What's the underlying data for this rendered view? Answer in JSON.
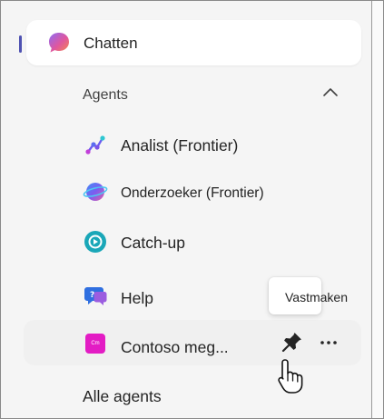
{
  "chat": {
    "label": "Chatten",
    "active": true
  },
  "agents_section": {
    "title": "Agents",
    "expanded": true,
    "items": [
      {
        "label": "Analist (Frontier)",
        "icon": "analist-icon"
      },
      {
        "label": "Onderzoeker (Frontier)",
        "icon": "onderzoeker-icon"
      },
      {
        "label": "Catch-up",
        "icon": "catch-up-icon"
      },
      {
        "label": "Help",
        "icon": "help-icon"
      },
      {
        "label": "Contoso meg...",
        "icon": "contoso-icon",
        "icon_text": "Cm",
        "hovered": true
      }
    ]
  },
  "tooltip": {
    "text": "Vastmaken"
  },
  "all_agents": {
    "label": "Alle agents"
  },
  "colors": {
    "accent": "#4f52b2",
    "contoso": "#e31cc4",
    "catchup": "#1aa7b8",
    "help": "#2f6fe0"
  }
}
